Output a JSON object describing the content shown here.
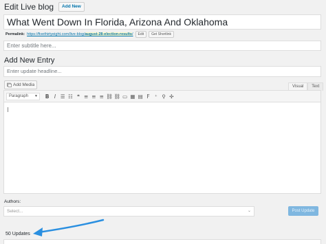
{
  "header": {
    "title": "Edit Live blog",
    "add_new_label": "Add New"
  },
  "post": {
    "title": "What Went Down In Florida, Arizona And Oklahoma",
    "permalink_label": "Permalink:",
    "permalink_base": "https://fivethirtyeight.com/live-blog/",
    "permalink_slug": "august-28-election-results",
    "permalink_trail": "/",
    "edit_label": "Edit",
    "shortlink_label": "Get Shortlink",
    "subtitle_placeholder": "Enter subtitle here..."
  },
  "entry": {
    "section_title": "Add New Entry",
    "headline_placeholder": "Enter update headline...",
    "add_media_label": "Add Media",
    "tabs": {
      "visual": "Visual",
      "text": "Text"
    },
    "format_value": "Paragraph",
    "toolbar_icons": [
      "bold-icon",
      "italic-icon",
      "bullet-list-icon",
      "numbered-list-icon",
      "blockquote-icon",
      "align-left-icon",
      "align-center-icon",
      "align-right-icon",
      "link-icon",
      "unlink-icon",
      "read-more-icon",
      "fullscreen-icon",
      "toolbar-toggle-icon",
      "footnote-icon",
      "special-char-icon",
      "embed-icon",
      "fullscreen-expand-icon"
    ],
    "toolbar_glyphs": {
      "bold": "B",
      "italic": "I",
      "ul": "☰",
      "ol": "☷",
      "quote": "❝",
      "alignl": "≡",
      "alignc": "≡",
      "alignr": "≡",
      "link": "⛓",
      "unlink": "⛓",
      "more": "▭",
      "fs": "▦",
      "kitchen": "▤",
      "fn": "F",
      "special": "⁺",
      "embed": "⚲",
      "expand": "✣"
    }
  },
  "authors": {
    "label": "Authors:",
    "select_placeholder": "Select...",
    "post_update_label": "Post Update"
  },
  "updates": {
    "count_label": "50 Updates"
  },
  "colors": {
    "accent": "#0073aa",
    "post_button": "#7fb7e0",
    "arrow": "#2a8fe0"
  }
}
